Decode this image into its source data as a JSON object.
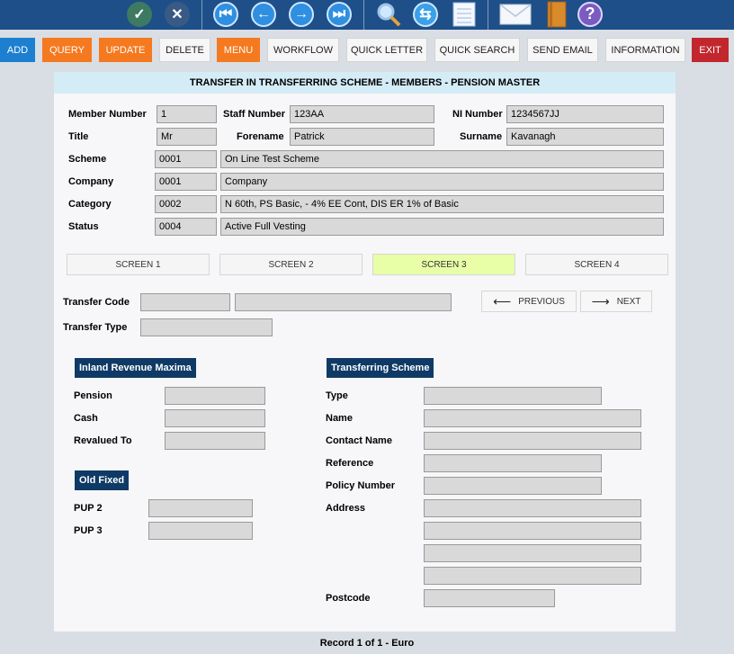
{
  "toolbar": {
    "icons": [
      "check-icon",
      "cancel-icon",
      "first-record-icon",
      "previous-record-icon",
      "next-record-icon",
      "last-record-icon",
      "search-icon",
      "refresh-icon",
      "notepad-icon",
      "mail-icon",
      "book-icon",
      "help-icon"
    ]
  },
  "buttons": {
    "add": "ADD",
    "query": "QUERY",
    "update": "UPDATE",
    "delete": "DELETE",
    "menu": "MENU",
    "workflow": "WORKFLOW",
    "quick_letter": "QUICK LETTER",
    "quick_search": "QUICK SEARCH",
    "send_email": "SEND EMAIL",
    "information": "INFORMATION",
    "exit": "EXIT"
  },
  "colors": {
    "toolbar": "#1e4f88",
    "add": "#1d7fcf",
    "orange": "#f5791f",
    "exit": "#c1272d",
    "section": "#0f3a66",
    "active_tab": "#e8ffa8",
    "title_bar": "#d4ecf6"
  },
  "panel_title": "TRANSFER IN TRANSFERRING SCHEME - MEMBERS - PENSION MASTER",
  "member": {
    "member_number_label": "Member Number",
    "member_number": "1",
    "staff_number_label": "Staff Number",
    "staff_number": "123AA",
    "ni_number_label": "NI Number",
    "ni_number": "1234567JJ",
    "title_label": "Title",
    "title": "Mr",
    "forename_label": "Forename",
    "forename": "Patrick",
    "surname_label": "Surname",
    "surname": "Kavanagh",
    "scheme_label": "Scheme",
    "scheme_code": "0001",
    "scheme_name": "On Line Test Scheme",
    "company_label": "Company",
    "company_code": "0001",
    "company_name": "Company",
    "category_label": "Category",
    "category_code": "0002",
    "category_name": "N 60th,  PS Basic, - 4% EE Cont, DIS ER 1% of Basic",
    "status_label": "Status",
    "status_code": "0004",
    "status_name": "Active Full Vesting"
  },
  "tabs": [
    "SCREEN 1",
    "SCREEN 2",
    "SCREEN 3",
    "SCREEN 4"
  ],
  "active_tab": "SCREEN 3",
  "transfer": {
    "code_label": "Transfer Code",
    "code": "",
    "code_desc": "",
    "type_label": "Transfer Type",
    "type": ""
  },
  "nav": {
    "previous": "PREVIOUS",
    "next": "NEXT"
  },
  "inland_revenue": {
    "header": "Inland Revenue Maxima",
    "pension_label": "Pension",
    "pension": "",
    "cash_label": "Cash",
    "cash": "",
    "revalued_label": "Revalued To",
    "revalued": ""
  },
  "old_fixed": {
    "header": "Old Fixed",
    "pup2_label": "PUP 2",
    "pup2": "",
    "pup3_label": "PUP 3",
    "pup3": ""
  },
  "transferring_scheme": {
    "header": "Transferring Scheme",
    "type_label": "Type",
    "type": "",
    "name_label": "Name",
    "name": "",
    "contact_label": "Contact Name",
    "contact": "",
    "reference_label": "Reference",
    "reference": "",
    "policy_label": "Policy Number",
    "policy": "",
    "address_label": "Address",
    "address1": "",
    "address2": "",
    "address3": "",
    "address4": "",
    "postcode_label": "Postcode",
    "postcode": ""
  },
  "footer": "Record 1 of 1 - Euro"
}
